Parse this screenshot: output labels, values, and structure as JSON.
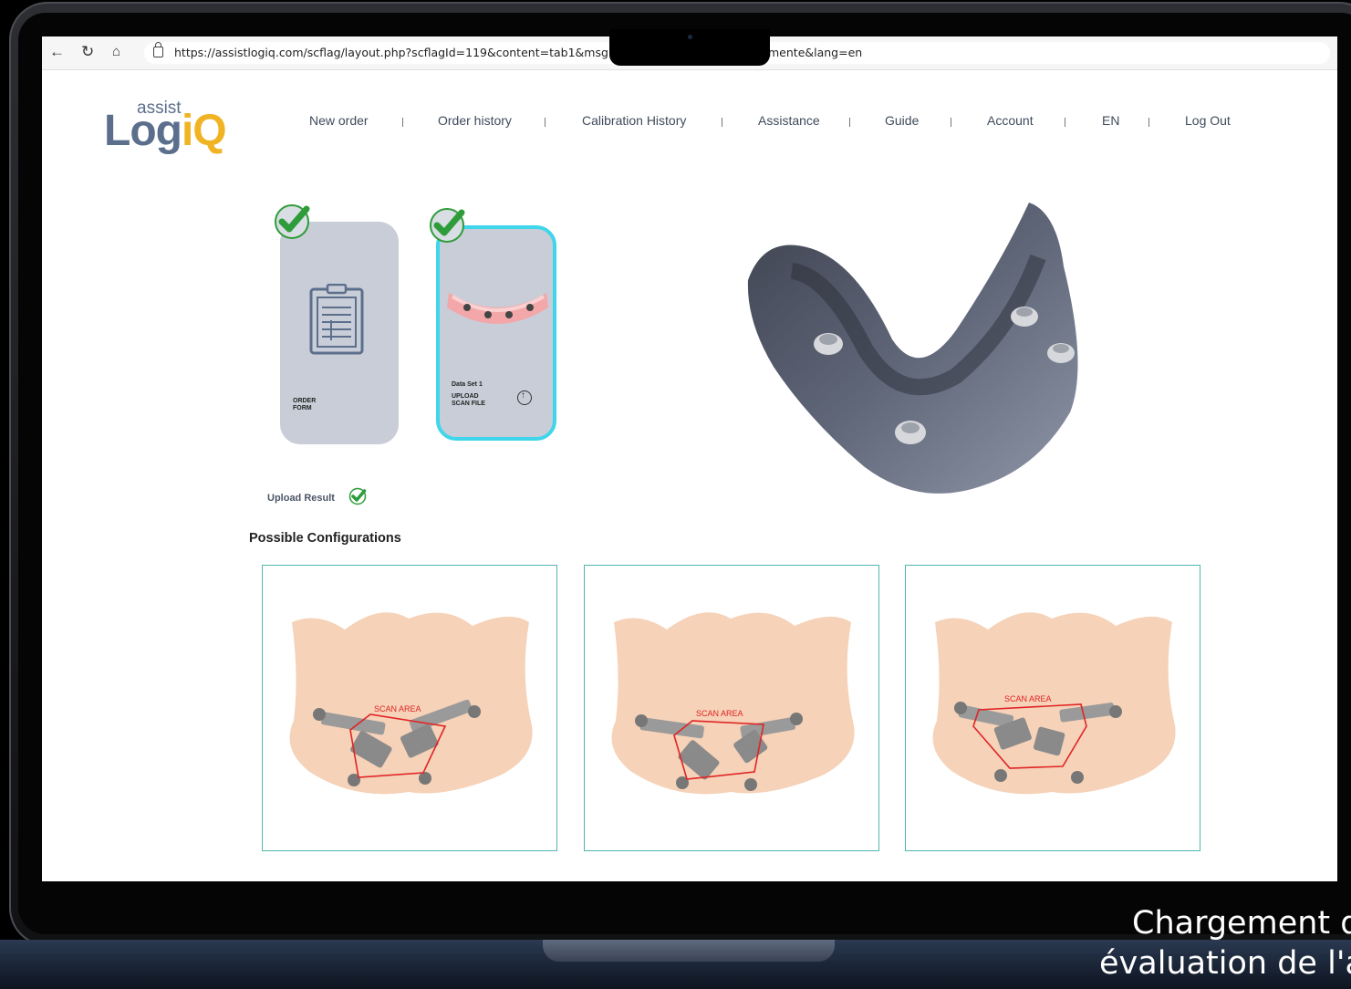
{
  "browser": {
    "url_start": "https://assistlogiq.com/scflag/layout.php?scflagId=119&content=tab1&msg=",
    "url_end": "mente&lang=en",
    "icons": [
      "back-arrow-icon",
      "reload-icon",
      "home-icon",
      "lock-icon"
    ]
  },
  "logo": {
    "small": "assist",
    "big_part1": "Log",
    "big_part2": "iQ"
  },
  "nav": {
    "items": [
      {
        "label": "New order"
      },
      {
        "label": "Order history"
      },
      {
        "label": "Calibration History"
      },
      {
        "label": "Assistance"
      },
      {
        "label": "Guide"
      },
      {
        "label": "Account"
      },
      {
        "label": "EN"
      },
      {
        "label": "Log Out"
      }
    ]
  },
  "cards": {
    "order_form": {
      "line1": "ORDER",
      "line2": "FORM"
    },
    "data_set": {
      "title": "Data Set 1",
      "line1": "UPLOAD",
      "line2": "SCAN FILE"
    }
  },
  "upload_result": "Upload Result",
  "section_title": "Possible Configurations",
  "configs": [
    {
      "label": "SCAN AREA"
    },
    {
      "label": "SCAN AREA"
    },
    {
      "label": "SCAN AREA"
    }
  ],
  "colors": {
    "accent_cyan": "#3fd5ea",
    "config_border": "#4fb7ad",
    "check_green": "#2e9c3a",
    "scan_red": "#e02424",
    "logo_blue": "#5b6f8c",
    "logo_yellow": "#f0b323"
  },
  "caption": {
    "line1": "Chargement d",
    "line2": "évaluation de l'a"
  }
}
